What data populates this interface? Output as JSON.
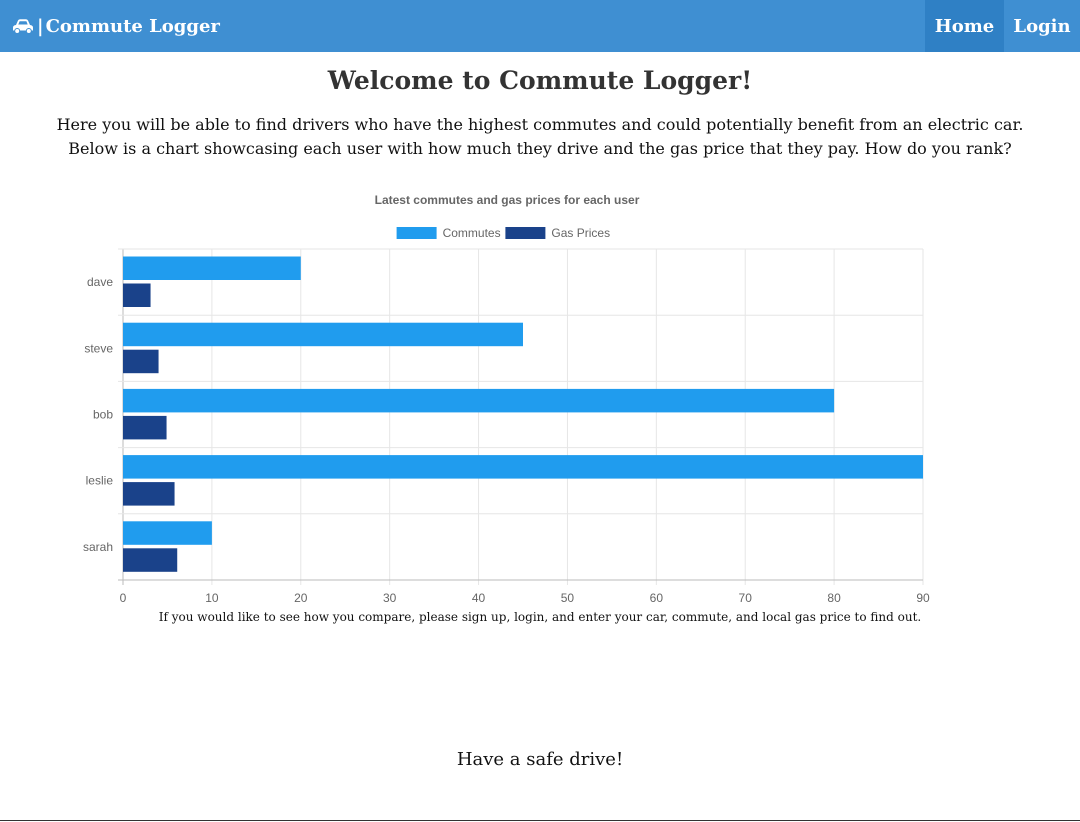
{
  "nav": {
    "brand_label": "Commute Logger",
    "brand_icon": "car-icon",
    "links": [
      {
        "label": "Home",
        "active": true
      },
      {
        "label": "Login",
        "active": false
      }
    ]
  },
  "main": {
    "title": "Welcome to Commute Logger!",
    "intro_line_1": "Here you will be able to find drivers who have the highest commutes and could potentially benefit from an electric car.",
    "intro_line_2": "Below is a chart showcasing each user with how much they drive and the gas price that they pay. How do you rank?",
    "footnote": "If you would like to see how you compare, please sign up, login, and enter your car, commute, and local gas price to find out.",
    "farewell": "Have a safe drive!"
  },
  "colors": {
    "navbar": "#3f8fd2",
    "nav_active": "#2f80c5",
    "commutes": "#209cee",
    "gas_prices": "#1a428a"
  },
  "chart_data": {
    "type": "bar",
    "orientation": "horizontal",
    "title": "Latest commutes and gas prices for each user",
    "categories": [
      "dave",
      "steve",
      "bob",
      "leslie",
      "sarah"
    ],
    "series": [
      {
        "name": "Commutes",
        "values": [
          20,
          45,
          80,
          90,
          10
        ],
        "color": "#209cee"
      },
      {
        "name": "Gas Prices",
        "values": [
          3.1,
          4,
          4.9,
          5.8,
          6.1
        ],
        "color": "#1a428a"
      }
    ],
    "xlim": [
      0,
      90
    ],
    "xticks": [
      0,
      10,
      20,
      30,
      40,
      50,
      60,
      70,
      80,
      90
    ],
    "grid": true,
    "legend_position": "top"
  }
}
